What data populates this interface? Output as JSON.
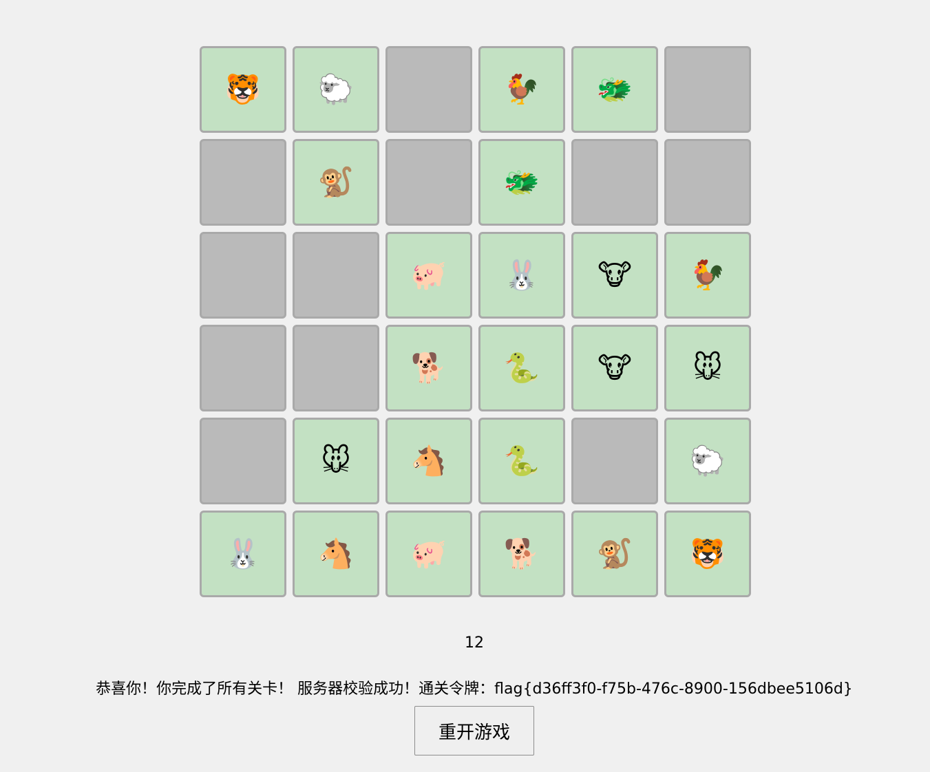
{
  "board": {
    "cards": [
      {
        "icon": "tiger-icon",
        "glyph": "🐯",
        "state": "revealed"
      },
      {
        "icon": "sheep-icon",
        "glyph": "🐑",
        "state": "revealed"
      },
      {
        "icon": "",
        "glyph": "",
        "state": "hidden"
      },
      {
        "icon": "rooster-icon",
        "glyph": "🐓",
        "state": "revealed"
      },
      {
        "icon": "dragon-icon",
        "glyph": "🐲",
        "state": "revealed"
      },
      {
        "icon": "",
        "glyph": "",
        "state": "hidden"
      },
      {
        "icon": "",
        "glyph": "",
        "state": "hidden"
      },
      {
        "icon": "monkey-icon",
        "glyph": "🐒",
        "state": "revealed"
      },
      {
        "icon": "",
        "glyph": "",
        "state": "hidden"
      },
      {
        "icon": "dragon-icon",
        "glyph": "🐲",
        "state": "revealed"
      },
      {
        "icon": "",
        "glyph": "",
        "state": "hidden"
      },
      {
        "icon": "",
        "glyph": "",
        "state": "hidden"
      },
      {
        "icon": "",
        "glyph": "",
        "state": "hidden"
      },
      {
        "icon": "",
        "glyph": "",
        "state": "hidden"
      },
      {
        "icon": "pig-icon",
        "glyph": "🐖",
        "state": "revealed"
      },
      {
        "icon": "rabbit-icon",
        "glyph": "🐰",
        "state": "revealed"
      },
      {
        "icon": "cow-icon",
        "glyph": "🐮",
        "state": "revealed"
      },
      {
        "icon": "rooster-icon",
        "glyph": "🐓",
        "state": "revealed"
      },
      {
        "icon": "",
        "glyph": "",
        "state": "hidden"
      },
      {
        "icon": "",
        "glyph": "",
        "state": "hidden"
      },
      {
        "icon": "dog-icon",
        "glyph": "🐕",
        "state": "revealed"
      },
      {
        "icon": "snake-icon",
        "glyph": "🐍",
        "state": "revealed"
      },
      {
        "icon": "cow-icon",
        "glyph": "🐮",
        "state": "revealed"
      },
      {
        "icon": "mouse-icon",
        "glyph": "🐭",
        "state": "revealed"
      },
      {
        "icon": "",
        "glyph": "",
        "state": "hidden"
      },
      {
        "icon": "mouse-icon",
        "glyph": "🐭",
        "state": "revealed"
      },
      {
        "icon": "horse-icon",
        "glyph": "🐴",
        "state": "revealed"
      },
      {
        "icon": "snake-icon",
        "glyph": "🐍",
        "state": "revealed"
      },
      {
        "icon": "",
        "glyph": "",
        "state": "hidden"
      },
      {
        "icon": "sheep-icon",
        "glyph": "🐑",
        "state": "revealed"
      },
      {
        "icon": "rabbit-icon",
        "glyph": "🐰",
        "state": "revealed"
      },
      {
        "icon": "horse-icon",
        "glyph": "🐴",
        "state": "revealed"
      },
      {
        "icon": "pig-icon",
        "glyph": "🐖",
        "state": "revealed"
      },
      {
        "icon": "dog-icon",
        "glyph": "🐕",
        "state": "revealed"
      },
      {
        "icon": "monkey-icon",
        "glyph": "🐒",
        "state": "revealed"
      },
      {
        "icon": "tiger-icon",
        "glyph": "🐯",
        "state": "revealed"
      }
    ]
  },
  "status": {
    "counter": "12",
    "message": "恭喜你！你完成了所有关卡！ 服务器校验成功！通关令牌：flag{d36ff3f0-f75b-476c-8900-156dbee5106d}"
  },
  "controls": {
    "restart_label": "重开游戏"
  },
  "colors": {
    "revealed": "#c3e1c3",
    "hidden": "#bababa",
    "border": "#a9a9a9",
    "background": "#f0f0f0"
  }
}
